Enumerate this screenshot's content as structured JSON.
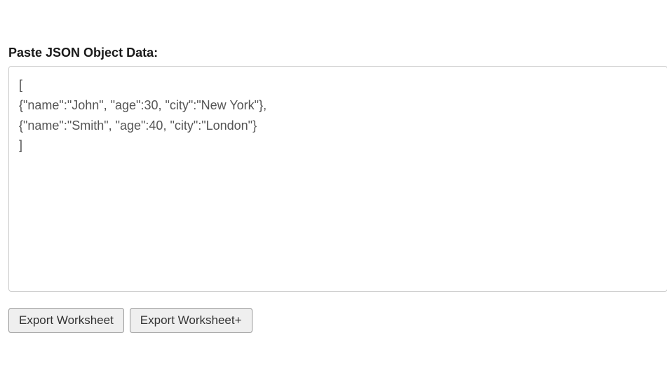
{
  "form": {
    "label": "Paste JSON Object Data:",
    "textarea_value": "[\n{\"name\":\"John\", \"age\":30, \"city\":\"New York\"},\n{\"name\":\"Smith\", \"age\":40, \"city\":\"London\"}\n]"
  },
  "buttons": {
    "export": "Export Worksheet",
    "export_plus": "Export Worksheet+"
  }
}
